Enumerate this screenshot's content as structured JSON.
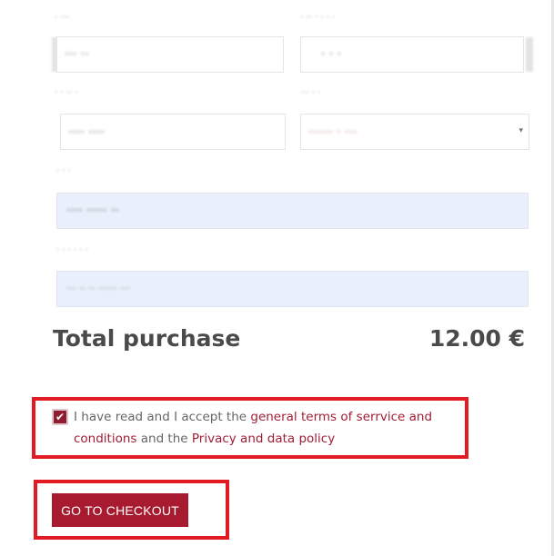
{
  "form": {
    "rows": [
      {
        "left": {
          "label": "· ···",
          "value": "··· ··"
        },
        "right": {
          "label": "· ·· · · · ·",
          "value": "· · ·"
        }
      },
      {
        "left": {
          "label": "· · ·· ·",
          "value": "···· ····"
        },
        "right": {
          "label": "··· · ·",
          "value": "······ · ···"
        }
      }
    ],
    "email": {
      "label": "· · ·",
      "value": "···· ····· ··"
    },
    "confirm": {
      "label": "· · · · · ·",
      "value": "··· ·· ·· ······ ···"
    }
  },
  "total": {
    "label": "Total purchase",
    "value": "12.00 €"
  },
  "terms": {
    "checked": true,
    "check_glyph": "✔",
    "text_before": "I have read and I accept the ",
    "link_terms": "general terms of serrvice and conditions",
    "text_middle": " and the ",
    "link_privacy": "Privacy and data policy"
  },
  "checkout": {
    "label": "GO TO CHECKOUT"
  },
  "colors": {
    "accent": "#a81a2f",
    "highlight": "#e21b23",
    "filled_field": "#e9f0fb"
  }
}
